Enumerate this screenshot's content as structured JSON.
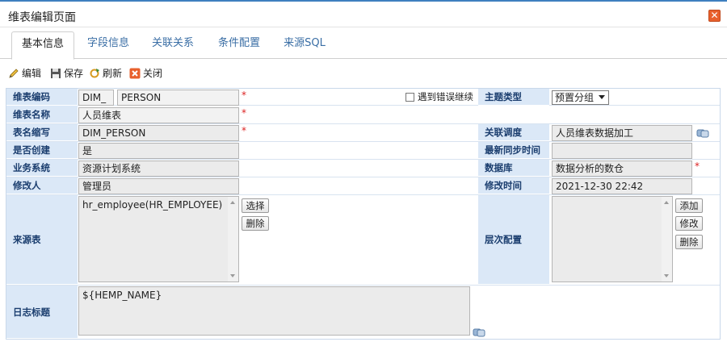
{
  "window": {
    "title": "维表编辑页面",
    "close_glyph": "✕"
  },
  "tabs": [
    {
      "label": "基本信息",
      "active": true
    },
    {
      "label": "字段信息",
      "active": false
    },
    {
      "label": "关联关系",
      "active": false
    },
    {
      "label": "条件配置",
      "active": false
    },
    {
      "label": "来源SQL",
      "active": false
    }
  ],
  "toolbar": {
    "edit": "编辑",
    "save": "保存",
    "refresh": "刷新",
    "close": "关闭"
  },
  "form": {
    "code_label": "维表编码",
    "code_prefix": "DIM_",
    "code_value": "PERSON",
    "skip_error_label": "遇到错误继续",
    "skip_error_checked": false,
    "subject_type_label": "主题类型",
    "subject_type_value": "预置分组",
    "name_label": "维表名称",
    "name_value": "人员维表",
    "abbr_label": "表名缩写",
    "abbr_value": "DIM_PERSON",
    "schedule_label": "关联调度",
    "schedule_value": "人员维表数据加工",
    "created_label": "是否创建",
    "created_value": "是",
    "last_sync_label": "最新同步时间",
    "last_sync_value": "",
    "biz_system_label": "业务系统",
    "biz_system_value": "资源计划系统",
    "database_label": "数据库",
    "database_value": "数据分析的数仓",
    "modifier_label": "修改人",
    "modifier_value": "管理员",
    "modified_time_label": "修改时间",
    "modified_time_value": "2021-12-30 22:42",
    "source_label": "来源表",
    "source_value": "hr_employee(HR_EMPLOYEE)",
    "source_select_btn": "选择",
    "source_delete_btn": "删除",
    "level_label": "层次配置",
    "level_value": "",
    "level_add_btn": "添加",
    "level_edit_btn": "修改",
    "level_delete_btn": "删除",
    "log_title_label": "日志标题",
    "log_title_value": "${HEMP_NAME}",
    "required_mark": "*"
  },
  "colors": {
    "label_bg": "#dbe8f7",
    "label_text": "#1a3d6e",
    "accent": "#3f7fbf",
    "required": "#dd2222",
    "close_btn": "#e8602c"
  }
}
